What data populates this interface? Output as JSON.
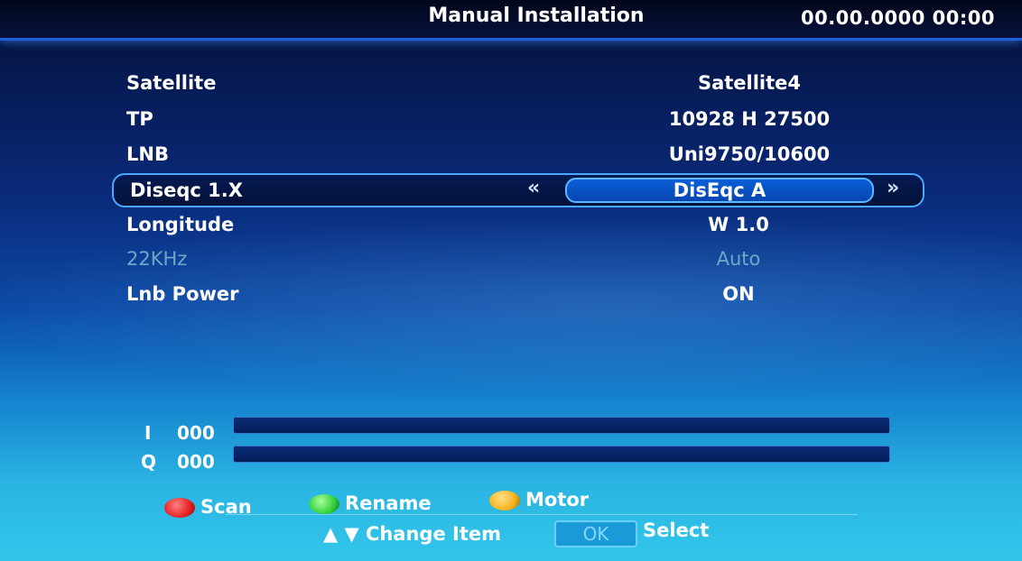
{
  "header": {
    "title": "Manual Installation",
    "datetime": "00.00.0000  00:00"
  },
  "settings": [
    {
      "label": "Satellite",
      "value": "Satellite4"
    },
    {
      "label": "TP",
      "value": "10928 H 27500"
    },
    {
      "label": "LNB",
      "value": "Uni9750/10600"
    },
    {
      "label": "Diseqc 1.X",
      "value": "DisEqc A"
    },
    {
      "label": "Longitude",
      "value": "W 1.0"
    },
    {
      "label": "22KHz",
      "value": "Auto"
    },
    {
      "label": "Lnb Power",
      "value": "ON"
    }
  ],
  "signal": {
    "intensity": {
      "label": "I",
      "value": "000",
      "level": 0
    },
    "quality": {
      "label": "Q",
      "value": "000",
      "level": 0
    }
  },
  "footer": {
    "scan_label": "Scan",
    "rename_label": "Rename",
    "motor_label": "Motor",
    "change_item_label": "Change Item",
    "ok_label": "OK",
    "select_label": "Select"
  },
  "colors": {
    "red": "#e52121",
    "green": "#2fd03a",
    "yellow": "#f5b21c",
    "accent": "#1c5fd6"
  },
  "icons": {
    "left": "double-left-arrow-icon",
    "right": "double-right-arrow-icon",
    "up": "up-triangle-icon",
    "down": "down-triangle-icon"
  }
}
